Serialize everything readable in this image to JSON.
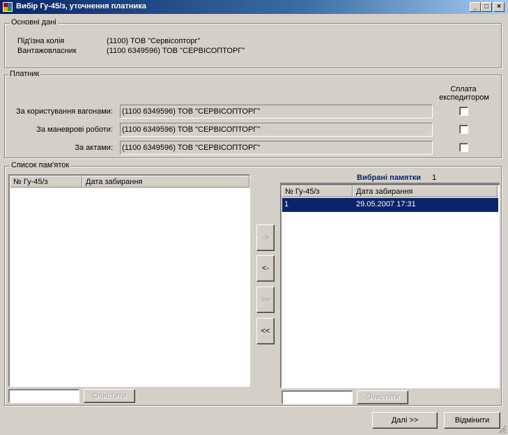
{
  "window": {
    "title": "Вибір Гу-45/з, уточнення платника",
    "minimize_glyph": "_",
    "maximize_glyph": "□",
    "close_glyph": "×"
  },
  "basic": {
    "legend": "Основні дані",
    "rows": [
      {
        "label": "Під'ізна колія",
        "value": "(1100) ТОВ \"Сервісопторг\""
      },
      {
        "label": "Вантажовласник",
        "value": "(1100  6349596) ТОВ \"СЕРВІСОПТОРГ\""
      }
    ]
  },
  "payer": {
    "legend": "Платник",
    "checkbox_header_line1": "Сплата",
    "checkbox_header_line2": "експедитором",
    "rows": [
      {
        "label": "За користування вагонами:",
        "value": "(1100  6349596) ТОВ \"СЕРВІСОПТОРГ\"",
        "checked": false
      },
      {
        "label": "За маневрові роботи:",
        "value": "(1100  6349596) ТОВ \"СЕРВІСОПТОРГ\"",
        "checked": false
      },
      {
        "label": "За актами:",
        "value": "(1100  6349596) ТОВ \"СЕРВІСОПТОРГ\"",
        "checked": false
      }
    ]
  },
  "memos": {
    "legend": "Список пам'яток",
    "left_list": {
      "columns": [
        "№ Гу-45/з",
        "Дата забирання"
      ],
      "rows": []
    },
    "left_clear_label": "Очистити",
    "left_filter_value": "",
    "transfer_buttons": {
      "add_one": "->",
      "remove_one": "<-",
      "add_all": ">>",
      "remove_all": "<<"
    },
    "selected": {
      "title": "Вибрані памятки",
      "count": "1",
      "columns": [
        "№ Гу-45/з",
        "Дата забирання"
      ],
      "rows": [
        {
          "num": "1",
          "date": "29.05.2007 17:31"
        }
      ]
    },
    "right_clear_label": "Очистити",
    "right_filter_value": ""
  },
  "footer": {
    "next_label": "Далі >>",
    "cancel_label": "Відмінити"
  }
}
